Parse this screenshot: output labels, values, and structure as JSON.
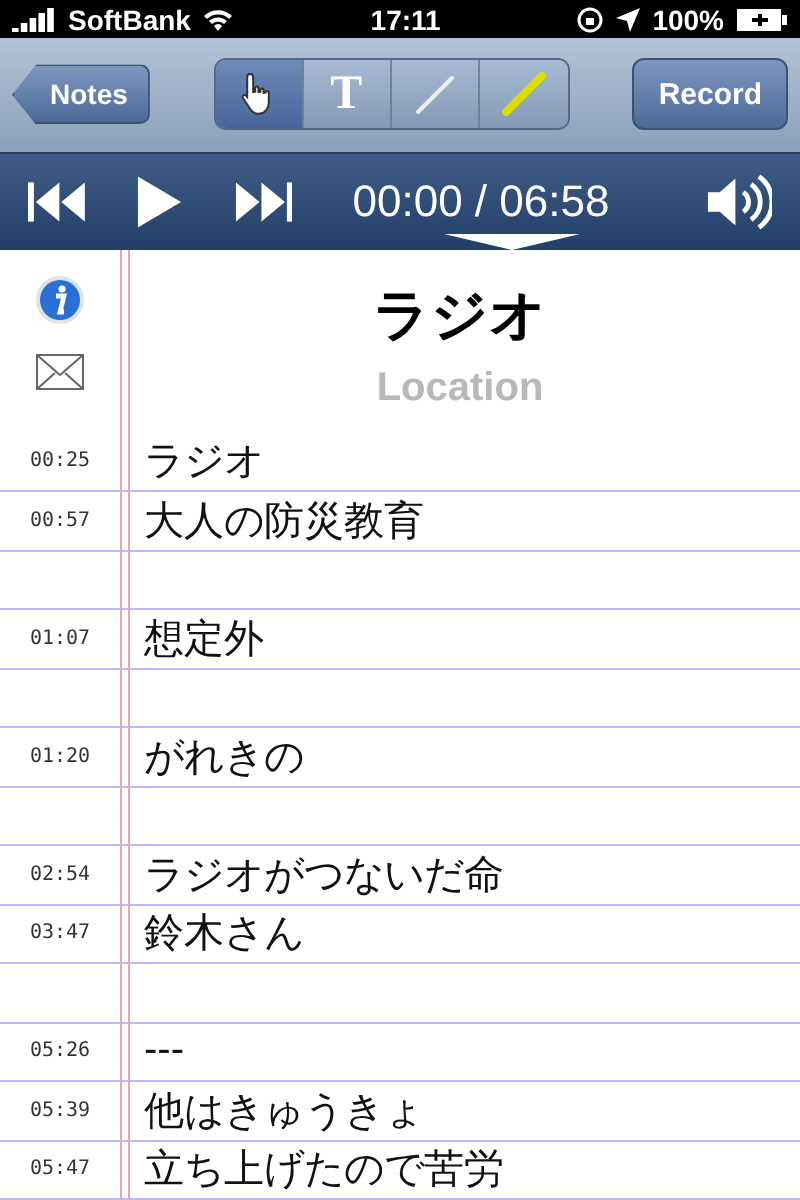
{
  "status_bar": {
    "carrier": "SoftBank",
    "time": "17:11",
    "battery": "100%"
  },
  "nav_bar": {
    "back_button": "Notes",
    "tools": [
      {
        "kind": "hand",
        "selected": true
      },
      {
        "kind": "text",
        "label": "T",
        "selected": false
      },
      {
        "kind": "pen",
        "selected": false
      },
      {
        "kind": "highlighter",
        "selected": false
      }
    ],
    "record_button": "Record"
  },
  "player": {
    "time": "00:00 / 06:58"
  },
  "note": {
    "title": "ラジオ",
    "subtitle": "Location"
  },
  "rows": [
    {
      "kind": "entry",
      "time": "00:25",
      "text": "ラジオ"
    },
    {
      "kind": "entry",
      "time": "00:57",
      "text": "大人の防災教育"
    },
    {
      "kind": "blank"
    },
    {
      "kind": "entry",
      "time": "01:07",
      "text": "想定外"
    },
    {
      "kind": "blank"
    },
    {
      "kind": "entry",
      "time": "01:20",
      "text": "がれきの"
    },
    {
      "kind": "blank"
    },
    {
      "kind": "entry",
      "time": "02:54",
      "text": "ラジオがつないだ命"
    },
    {
      "kind": "entry",
      "time": "03:47",
      "text": "鈴木さん"
    },
    {
      "kind": "blank"
    },
    {
      "kind": "entry",
      "time": "05:26",
      "text": "---"
    },
    {
      "kind": "entry",
      "time": "05:39",
      "text": "他はきゅうきょ"
    },
    {
      "kind": "entry",
      "time": "05:47",
      "text": "立ち上げたので苦労"
    }
  ]
}
